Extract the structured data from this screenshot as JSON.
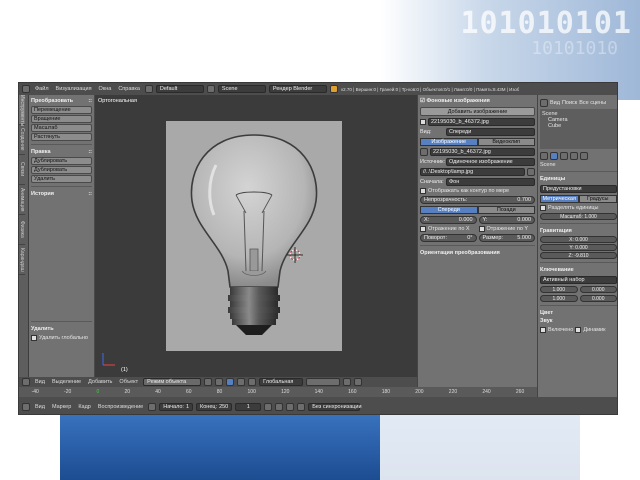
{
  "slide": {
    "binary": "101010101",
    "binary_faded": "10101010"
  },
  "app": {
    "topbar": {
      "menu": [
        "Файл",
        "Визуализация",
        "Окна",
        "Справка"
      ],
      "layout": "Default",
      "scene": "Scene",
      "engine": "Рендер Blender",
      "stats": "v2.70 | Вершин:0 | Граней:0 | Тр-ков:0 | Объектов:0/1 | Ламп:0/0 | Память:8.43M | Изображение"
    },
    "tabs": [
      "Инструменты",
      "Создание",
      "Связи",
      "Анимация",
      "Физика",
      "Карандаш"
    ],
    "toolshelf": {
      "transform_title": "Преобразовать",
      "transform_buttons": [
        "Перемещение",
        "Вращение",
        "Масштаб",
        "Растянуть"
      ],
      "edit_title": "Правка",
      "edit_buttons": [
        "Дублировать",
        "Дублировать связанный",
        "Удалить"
      ],
      "history_title": "История",
      "delete_title": "Удалить",
      "delete_option": "Удалить глобально"
    },
    "viewport": {
      "label": "Ортогональная",
      "object": "(1)",
      "header": {
        "items": [
          "Вид",
          "Выделение",
          "Добавить",
          "Объект"
        ],
        "mode": "Режим объекта",
        "pivot": "Глобальная"
      }
    },
    "ruler_ticks": [
      "-40",
      "-20",
      "0",
      "20",
      "40",
      "60",
      "80",
      "100",
      "120",
      "140",
      "160",
      "180",
      "200",
      "220",
      "240",
      "260"
    ],
    "timeline": {
      "items": [
        "Вид",
        "Маркер",
        "Кадр",
        "Воспроизведение"
      ],
      "start_label": "Начало:",
      "start": "1",
      "end_label": "Конец:",
      "end": "250",
      "current": "1",
      "sync": "Без синхронизации"
    },
    "props": {
      "background_panel": "Фоновые изображения",
      "add_image": "Добавить изображение",
      "image_name": "22195030_b_46372.jpg",
      "axis_label": "Вид:",
      "axis_value": "Спереди",
      "source_image": "Изображение",
      "source_clip": "Видеоклип",
      "file_name": "22195030_b_46372.jpg",
      "source_label": "Источник:",
      "source_value": "Одиночное изображение",
      "path": "//..\\Desktop\\lamp.jpg",
      "draw_label": "Сначала:",
      "draw_value": "Фон",
      "show_expanded": "Отображать как контур по мере",
      "opacity_label": "Непрозрачность:",
      "opacity": "0.700",
      "front": "Спереди",
      "back": "Позади",
      "x_label": "X:",
      "x": "0.000",
      "y_label": "Y:",
      "y": "0.000",
      "flip_x": "Отражение по X",
      "flip_y": "Отражение по Y",
      "size_label": "Размер:",
      "size": "5.000",
      "rotation_label": "Поворот:",
      "rotation": "0°",
      "transform_orient": "Ориентация преобразования"
    },
    "outliner": {
      "view_tabs": [
        "Вид",
        "Поиск",
        "Все сцены"
      ],
      "tree": [
        "Scene",
        "Camera",
        "Cube"
      ],
      "render_label": "Scene",
      "units_title": "Единицы",
      "preset_label": "Предустановки",
      "metric": "Метрическая",
      "degrees": "Градусы",
      "separate": "Разделять единицы",
      "scale": "Масштаб: 1.000",
      "gravity_title": "Гравитация",
      "gravity_vals": [
        "X: 0.000",
        "Y: 0.000",
        "Z: -9.810"
      ],
      "keying_title": "Ключевание",
      "keying_active": "Активный набор",
      "time_vals": [
        "1.000",
        "0.000",
        "1.000",
        "0.000"
      ],
      "color_title": "Цвет",
      "audio_title": "Звук",
      "audio_vals": [
        "Включено",
        "Динамик"
      ]
    }
  }
}
